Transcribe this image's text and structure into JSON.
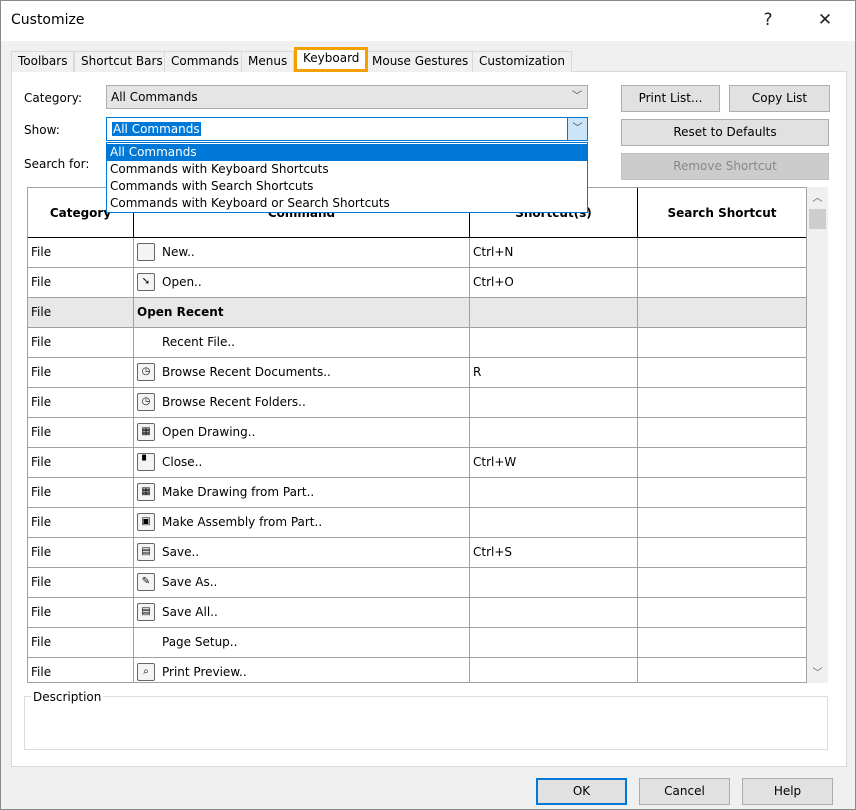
{
  "window": {
    "title": "Customize",
    "help_icon": "?",
    "close_icon": "✕"
  },
  "tabs": [
    {
      "label": "Toolbars"
    },
    {
      "label": "Shortcut Bars"
    },
    {
      "label": "Commands"
    },
    {
      "label": "Menus"
    },
    {
      "label": "Keyboard",
      "active": true
    },
    {
      "label": "Mouse Gestures"
    },
    {
      "label": "Customization"
    }
  ],
  "filters": {
    "category_label": "Category:",
    "category_value": "All Commands",
    "show_label": "Show:",
    "show_value": "All Commands",
    "search_label": "Search for:",
    "show_options": [
      "All Commands",
      "Commands with Keyboard Shortcuts",
      "Commands with Search Shortcuts",
      "Commands with Keyboard or Search Shortcuts"
    ]
  },
  "buttons": {
    "print_list": "Print List...",
    "copy_list": "Copy List",
    "reset": "Reset to Defaults",
    "remove": "Remove Shortcut",
    "ok": "OK",
    "cancel": "Cancel",
    "help": "Help"
  },
  "table": {
    "headers": [
      "Category",
      "Command",
      "Shortcut(s)",
      "Search Shortcut"
    ],
    "rows": [
      {
        "category": "File",
        "command": "New..",
        "shortcut": "Ctrl+N",
        "search": "",
        "icon": "new-document-icon"
      },
      {
        "category": "File",
        "command": "Open..",
        "shortcut": "Ctrl+O",
        "search": "",
        "icon": "open-folder-icon"
      },
      {
        "category": "File",
        "command": "Open Recent",
        "shortcut": "",
        "search": "",
        "group": true
      },
      {
        "category": "File",
        "command": "Recent File..",
        "shortcut": "",
        "search": ""
      },
      {
        "category": "File",
        "command": "Browse Recent Documents..",
        "shortcut": "R",
        "search": "",
        "icon": "recent-documents-icon"
      },
      {
        "category": "File",
        "command": "Browse Recent Folders..",
        "shortcut": "",
        "search": "",
        "icon": "recent-folders-icon"
      },
      {
        "category": "File",
        "command": "Open Drawing..",
        "shortcut": "",
        "search": "",
        "icon": "open-drawing-icon"
      },
      {
        "category": "File",
        "command": "Close..",
        "shortcut": "Ctrl+W",
        "search": "",
        "icon": "close-document-icon"
      },
      {
        "category": "File",
        "command": "Make Drawing from Part..",
        "shortcut": "",
        "search": "",
        "icon": "make-drawing-icon"
      },
      {
        "category": "File",
        "command": "Make Assembly from Part..",
        "shortcut": "",
        "search": "",
        "icon": "make-assembly-icon"
      },
      {
        "category": "File",
        "command": "Save..",
        "shortcut": "Ctrl+S",
        "search": "",
        "icon": "save-icon"
      },
      {
        "category": "File",
        "command": "Save As..",
        "shortcut": "",
        "search": "",
        "icon": "save-as-icon"
      },
      {
        "category": "File",
        "command": "Save All..",
        "shortcut": "",
        "search": "",
        "icon": "save-all-icon"
      },
      {
        "category": "File",
        "command": "Page Setup..",
        "shortcut": "",
        "search": ""
      },
      {
        "category": "File",
        "command": "Print Preview..",
        "shortcut": "",
        "search": "",
        "icon": "print-preview-icon"
      }
    ]
  },
  "description": {
    "label": "Description"
  },
  "colors": {
    "accent": "#0078d7",
    "tab_highlight": "#f5a000"
  }
}
